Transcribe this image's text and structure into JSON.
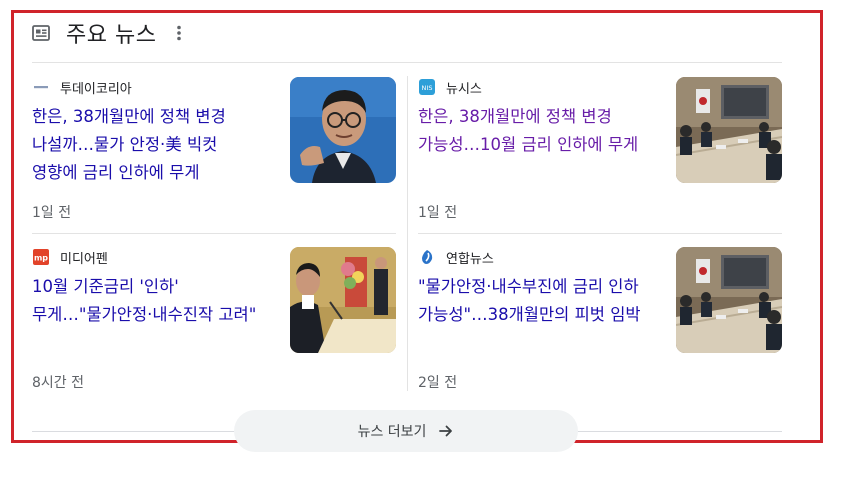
{
  "header": {
    "title": "주요 뉴스",
    "icon": "newspaper-icon",
    "menu_icon": "more-vert-icon"
  },
  "colors": {
    "frame": "#d0232a",
    "link": "#1a0dab",
    "visited": "#681da8",
    "meta": "#5f6368",
    "button_bg": "#f1f3f4"
  },
  "articles": [
    {
      "source": "투데이코리아",
      "logo_icon": "todaykorea-logo-icon",
      "headline": "한은, 38개월만에 정책 변경 나설까…물가 안정·美 빅컷 영향에 금리 인하에 무게",
      "time": "1일 전",
      "visited": false
    },
    {
      "source": "뉴시스",
      "logo_icon": "newsis-logo-icon",
      "headline": "한은, 38개월만에 정책 변경 가능성…10월 금리 인하에 무게",
      "time": "1일 전",
      "visited": true
    },
    {
      "source": "미디어펜",
      "logo_icon": "mediapen-logo-icon",
      "headline": "10월 기준금리 '인하' 무게…\"물가안정·내수진작 고려\"",
      "time": "8시간 전",
      "visited": false
    },
    {
      "source": "연합뉴스",
      "logo_icon": "yonhap-logo-icon",
      "headline": "\"물가안정·내수부진에 금리 인하 가능성\"…38개월만의 피벗 임박",
      "time": "2일 전",
      "visited": false
    }
  ],
  "more_button": {
    "label": "뉴스 더보기",
    "icon": "arrow-right-icon"
  }
}
